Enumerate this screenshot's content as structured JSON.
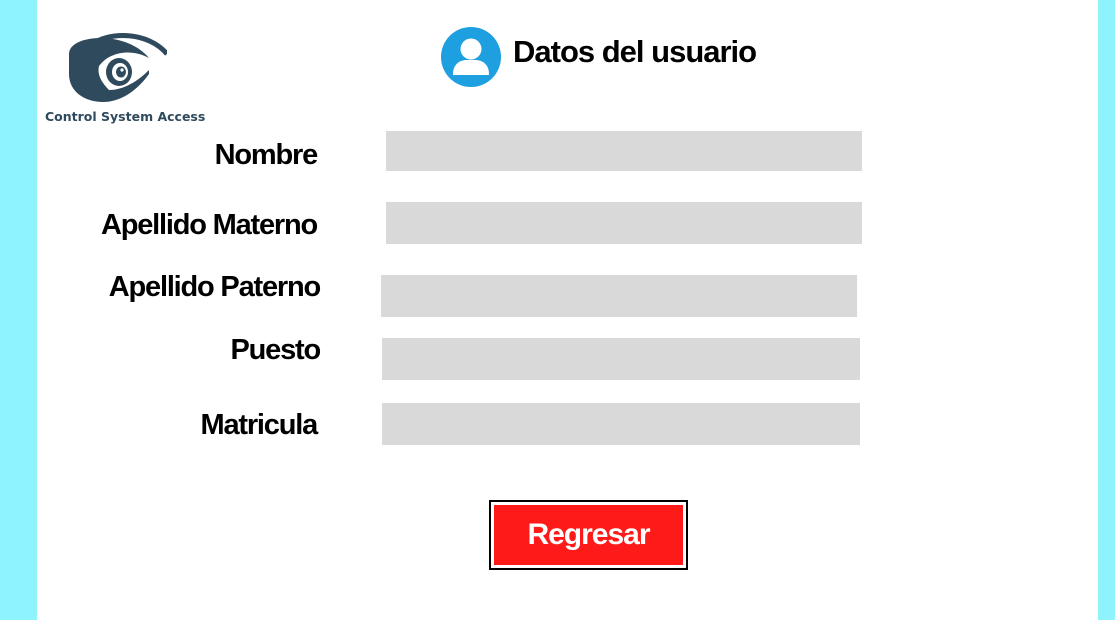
{
  "logo": {
    "icon": "security-camera-icon",
    "text": "Control System Access",
    "color": "#2f4a5c"
  },
  "header": {
    "icon": "user-avatar-icon",
    "icon_color": "#1e9fe0",
    "title": "Datos del usuario"
  },
  "form": {
    "fields": [
      {
        "label": "Nombre",
        "value": "",
        "placeholder": ""
      },
      {
        "label": "Apellido Materno",
        "value": "",
        "placeholder": ""
      },
      {
        "label": "Apellido Paterno",
        "value": "",
        "placeholder": ""
      },
      {
        "label": "Puesto",
        "value": "",
        "placeholder": ""
      },
      {
        "label": "Matricula",
        "value": "",
        "placeholder": ""
      }
    ],
    "input_color": "#d9d9d9"
  },
  "actions": {
    "back_label": "Regresar",
    "back_color": "#ff1a1a"
  },
  "colors": {
    "background": "#8ef3fd",
    "panel": "#ffffff"
  }
}
